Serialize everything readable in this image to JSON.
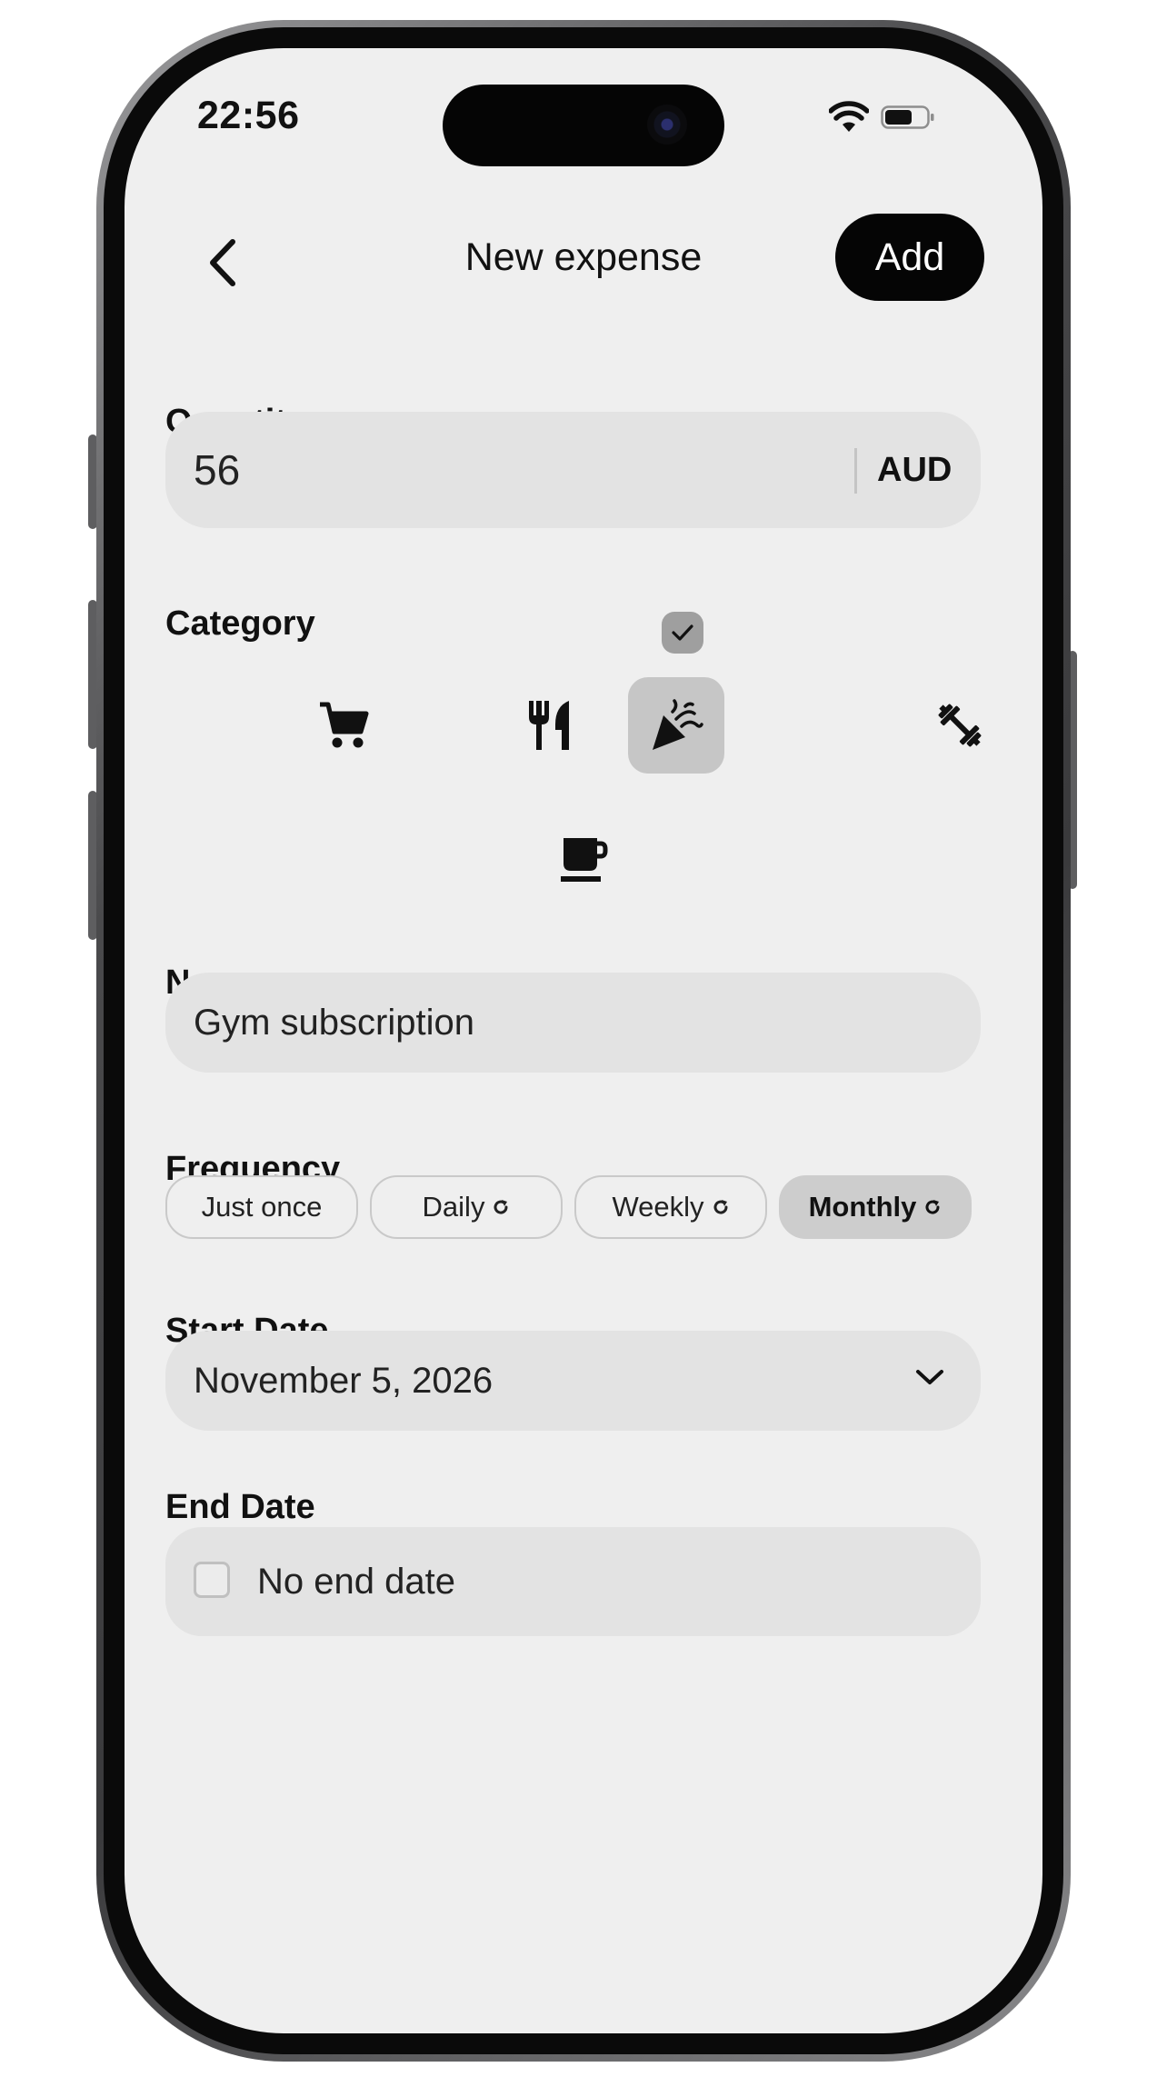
{
  "status_bar": {
    "time": "22:56"
  },
  "header": {
    "title": "New expense",
    "add_label": "Add"
  },
  "quantity": {
    "label": "Quantity",
    "value": "56",
    "currency": "AUD"
  },
  "category": {
    "label": "Category",
    "items": [
      {
        "icon": "shopping-cart-icon",
        "selected": false
      },
      {
        "icon": "fork-knife-icon",
        "selected": false
      },
      {
        "icon": "party-popper-icon",
        "selected": true
      },
      {
        "icon": "dumbbell-icon",
        "selected": false
      },
      {
        "icon": "coffee-cup-icon",
        "selected": false
      }
    ]
  },
  "name": {
    "label": "Name",
    "value": "Gym subscription"
  },
  "frequency": {
    "label": "Frequency",
    "options": [
      {
        "label": "Just once",
        "repeat": false,
        "selected": false
      },
      {
        "label": "Daily",
        "repeat": true,
        "selected": false
      },
      {
        "label": "Weekly",
        "repeat": true,
        "selected": false
      },
      {
        "label": "Monthly",
        "repeat": true,
        "selected": true
      }
    ]
  },
  "start_date": {
    "label": "Start Date",
    "value": "November 5, 2026"
  },
  "end_date": {
    "label": "End Date",
    "checkbox_label": "No end date",
    "checked": false
  },
  "colors": {
    "background": "#efefef",
    "field": "#e3e3e3",
    "primary": "#050505",
    "selected": "#c6c6c6"
  }
}
